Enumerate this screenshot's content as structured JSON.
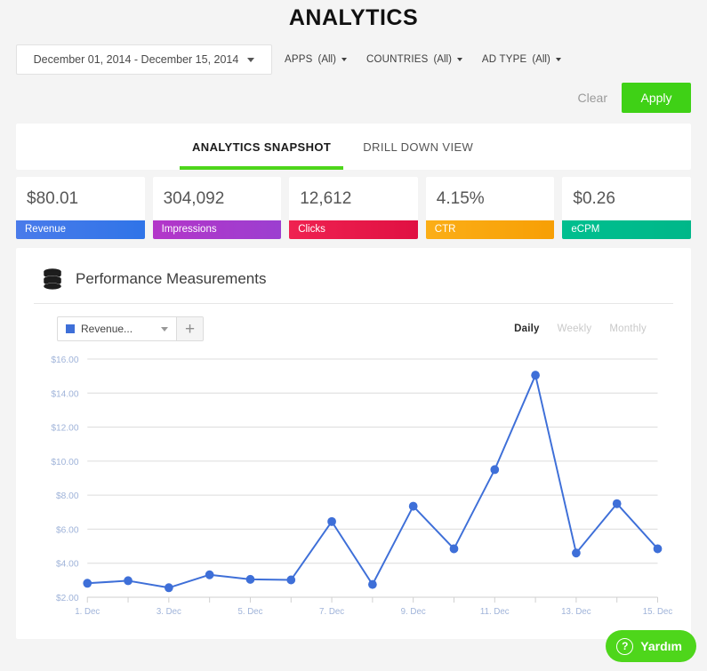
{
  "page_title": "ANALYTICS",
  "filters": {
    "date_range": "December 01, 2014 - December 15, 2014",
    "groups": [
      {
        "label": "APPS",
        "value": "(All)"
      },
      {
        "label": "COUNTRIES",
        "value": "(All)"
      },
      {
        "label": "AD TYPE",
        "value": "(All)"
      }
    ],
    "clear_label": "Clear",
    "apply_label": "Apply",
    "apply_color": "#3fd116"
  },
  "tabs": [
    {
      "label": "ANALYTICS SNAPSHOT",
      "active": true
    },
    {
      "label": "DRILL DOWN VIEW",
      "active": false
    }
  ],
  "tab_accent_color": "#4ed61b",
  "kpis": [
    {
      "value": "$80.01",
      "label": "Revenue",
      "color_from": "#4a7bea",
      "color_to": "#2f74e8"
    },
    {
      "value": "304,092",
      "label": "Impressions",
      "color_from": "#b335c9",
      "color_to": "#9c3fd0"
    },
    {
      "value": "12,612",
      "label": "Clicks",
      "color_from": "#ef2251",
      "color_to": "#e01042"
    },
    {
      "value": "4.15%",
      "label": "CTR",
      "color_from": "#fbae17",
      "color_to": "#f79f05"
    },
    {
      "value": "$0.26",
      "label": "eCPM",
      "color_from": "#00bf8f",
      "color_to": "#00b789"
    }
  ],
  "chart_panel": {
    "title": "Performance Measurements",
    "icon": "database-icon",
    "series_selector": {
      "text": "Revenue...",
      "swatch_color": "#3e6fd8",
      "add_label": "+"
    },
    "granularity": [
      {
        "label": "Daily",
        "active": true
      },
      {
        "label": "Weekly",
        "active": false
      },
      {
        "label": "Monthly",
        "active": false
      }
    ]
  },
  "chart_data": {
    "type": "line",
    "title": "Performance Measurements",
    "xlabel": "",
    "ylabel": "",
    "series": [
      {
        "name": "Revenue",
        "color": "#3e6fd8",
        "values": [
          2.82,
          2.97,
          2.56,
          3.32,
          3.05,
          3.02,
          6.45,
          2.75,
          7.35,
          4.85,
          9.5,
          15.05,
          4.6,
          7.5,
          4.85
        ]
      }
    ],
    "x": [
      "1. Dec",
      "2. Dec",
      "3. Dec",
      "4. Dec",
      "5. Dec",
      "6. Dec",
      "7. Dec",
      "8. Dec",
      "9. Dec",
      "10. Dec",
      "11. Dec",
      "12. Dec",
      "13. Dec",
      "14. Dec",
      "15. Dec"
    ],
    "x_tick_labels": [
      "1. Dec",
      "3. Dec",
      "5. Dec",
      "7. Dec",
      "9. Dec",
      "11. Dec",
      "13. Dec",
      "15. Dec"
    ],
    "y_tick_labels": [
      "$2.00",
      "$4.00",
      "$6.00",
      "$8.00",
      "$10.00",
      "$12.00",
      "$14.00",
      "$16.00"
    ],
    "y_ticks": [
      2,
      4,
      6,
      8,
      10,
      12,
      14,
      16
    ],
    "ylim": [
      2,
      16
    ],
    "grid": true,
    "legend": "none"
  },
  "help": {
    "label": "Yardım",
    "icon": "question-mark-icon",
    "color": "#4ed61b"
  }
}
